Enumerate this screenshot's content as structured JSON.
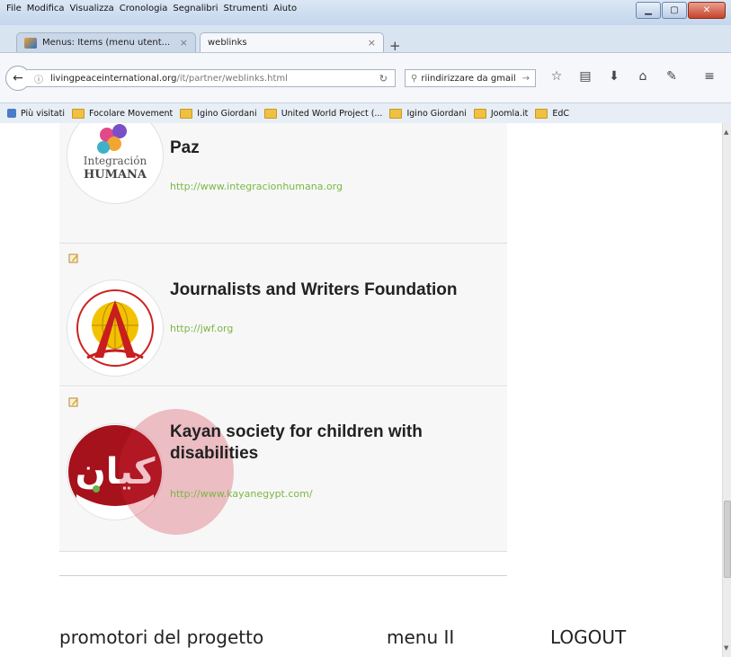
{
  "menu": [
    "File",
    "Modifica",
    "Visualizza",
    "Cronologia",
    "Segnalibri",
    "Strumenti",
    "Aiuto"
  ],
  "tabs": [
    {
      "label": "Menus: Items (menu utent..."
    },
    {
      "label": "weblinks"
    }
  ],
  "address": {
    "domain": "livingpeaceinternational.org",
    "path": "/it/partner/weblinks.html"
  },
  "search": {
    "value": "riindirizzare da gmail"
  },
  "bookmarks": [
    "Più visitati",
    "Focolare Movement",
    "Igino Giordani",
    "United World Project (...",
    "Igino Giordani",
    "Joomla.it",
    "EdC"
  ],
  "links": [
    {
      "name": "Integracion HUMANA - Semillas de Paz",
      "name_visible": "Paz",
      "url": "http://www.integracionhumana.org",
      "logo_text": [
        "Integración",
        "HUMANA"
      ]
    },
    {
      "name": "Journalists and Writers Foundation",
      "url": "http://jwf.org"
    },
    {
      "name": "Kayan society for children with disabilities",
      "url": "http://www.kayanegypt.com/"
    }
  ],
  "footer": {
    "left": "promotori del progetto",
    "middle": "menu II",
    "right": "LOGOUT"
  },
  "colors": {
    "link": "#7ab844",
    "accent": "#c8102e"
  }
}
